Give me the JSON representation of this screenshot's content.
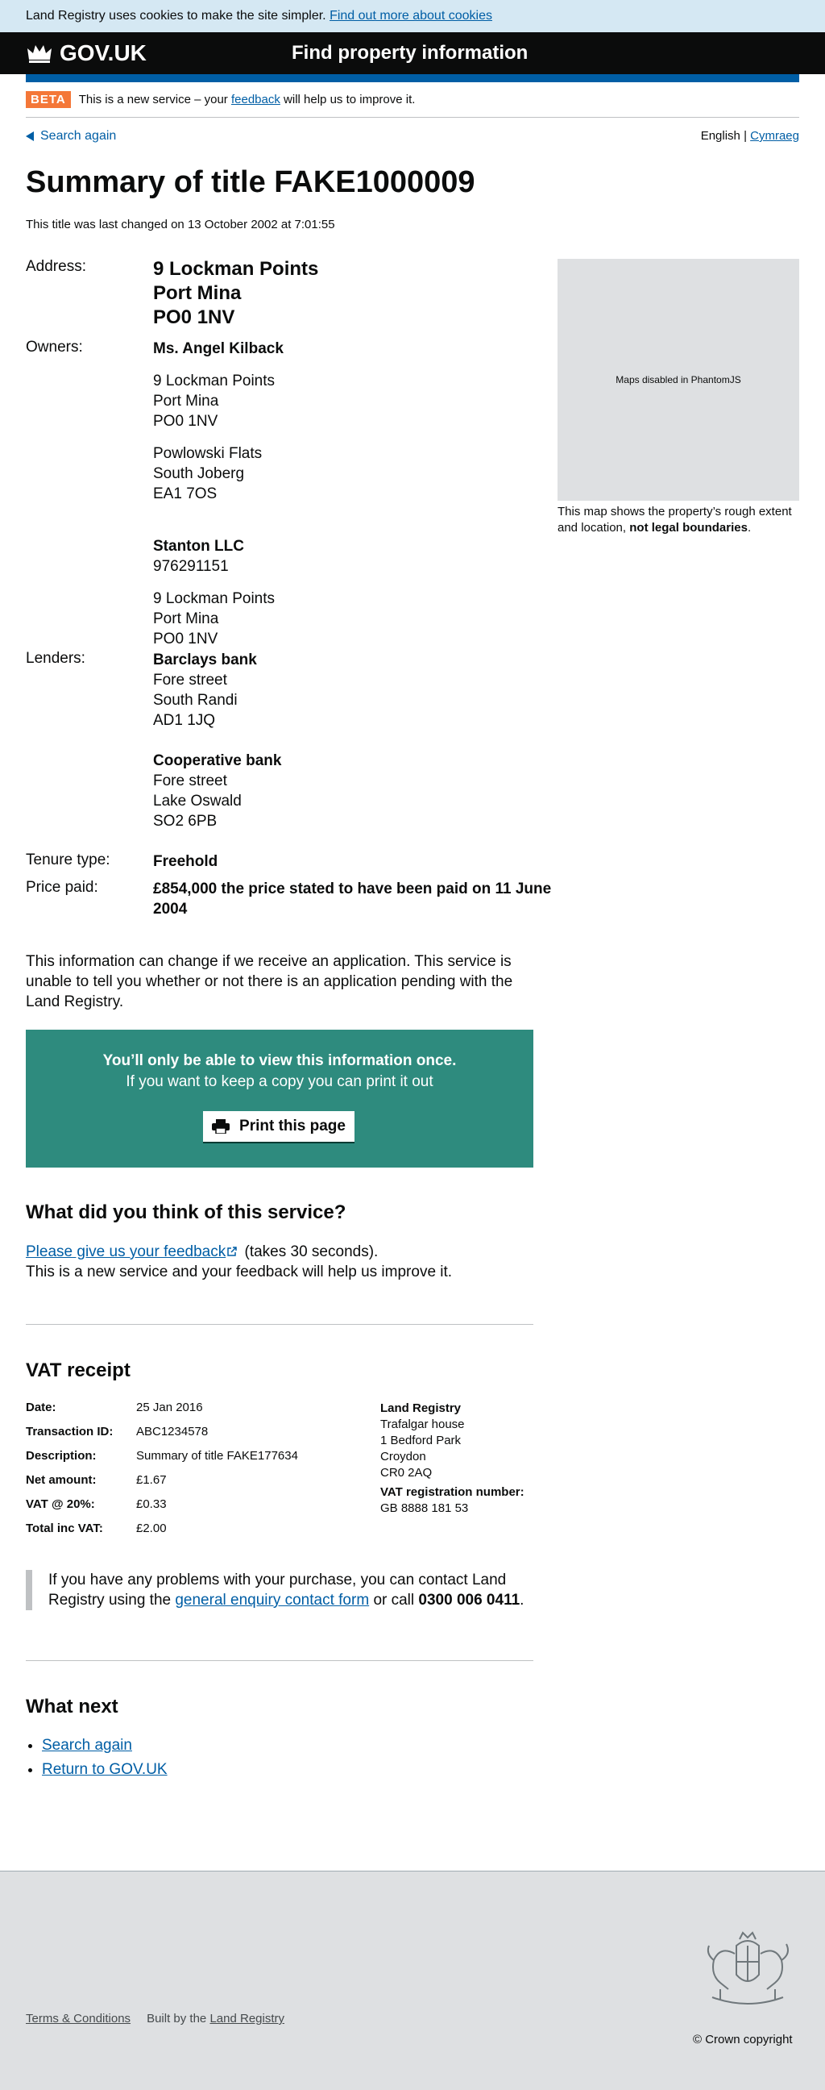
{
  "cookie": {
    "text": "Land Registry uses cookies to make the site simpler.",
    "link": "Find out more about cookies"
  },
  "header": {
    "logo": "GOV.UK",
    "service": "Find property information"
  },
  "beta": {
    "tag": "BETA",
    "pre": "This is a new service – your",
    "link": "feedback",
    "post": "will help us to improve it."
  },
  "nav": {
    "back": "Search again",
    "lang_en": "English |",
    "lang_cy": "Cymraeg"
  },
  "title": "Summary of title FAKE1000009",
  "changed": "This title was last changed on 13 October 2002 at 7:01:55",
  "labels": {
    "address": "Address:",
    "owners": "Owners:",
    "lenders": "Lenders:",
    "tenure": "Tenure type:",
    "price": "Price paid:"
  },
  "address": [
    "9 Lockman Points",
    "Port Mina",
    "PO0 1NV"
  ],
  "owners": {
    "o1_name": "Ms. Angel Kilback",
    "o1_addr1": [
      "9 Lockman Points",
      "Port Mina",
      "PO0 1NV"
    ],
    "o1_addr2": [
      "Powlowski Flats",
      "South Joberg",
      "EA1 7OS"
    ],
    "o2_name": "Stanton LLC",
    "o2_number": "976291151",
    "o2_addr": [
      "9 Lockman Points",
      "Port Mina",
      "PO0 1NV"
    ]
  },
  "lenders": {
    "l1_name": "Barclays bank",
    "l1_addr": [
      "Fore street",
      "South Randi",
      "AD1 1JQ"
    ],
    "l2_name": "Cooperative bank",
    "l2_addr": [
      "Fore street",
      "Lake Oswald",
      "SO2 6PB"
    ]
  },
  "tenure": "Freehold",
  "price": [
    "£854,000 the price stated to have been paid on 11 June",
    "2004"
  ],
  "map": {
    "placeholder": "Maps disabled in PhantomJS",
    "caption": "This map shows the property’s rough extent and location,",
    "caption_bold": "not legal boundaries",
    "caption_end": "."
  },
  "info": [
    "This information can change if we receive an application. This service is",
    "unable to tell you whether or not there is an application pending with the",
    "Land Registry."
  ],
  "print": {
    "line1": "You’ll only be able to view this information once.",
    "line2": "If you want to keep a copy you can print it out",
    "button": "Print this page"
  },
  "feedback": {
    "heading": "What did you think of this service?",
    "link": "Please give us your feedback",
    "after": "(takes 30 seconds).",
    "line2": "This is a new service and your feedback will help us improve it."
  },
  "vat": {
    "heading": "VAT receipt",
    "rows": [
      {
        "k": "Date:",
        "v": "25 Jan 2016"
      },
      {
        "k": "Transaction ID:",
        "v": "ABC1234578"
      },
      {
        "k": "Description:",
        "v": "Summary of title FAKE177634"
      },
      {
        "k": "Net amount:",
        "v": "£1.67"
      },
      {
        "k": "VAT @ 20%:",
        "v": "£0.33"
      },
      {
        "k": "Total inc VAT:",
        "v": "£2.00"
      }
    ],
    "lr_name": "Land Registry",
    "lr_addr": [
      "Trafalgar house",
      "1 Bedford Park",
      "Croydon",
      "CR0 2AQ"
    ],
    "reg_label": "VAT registration number:",
    "reg_number": "GB 8888 181 53"
  },
  "contact": {
    "pre": "If you have any problems with your purchase, you can contact Land Registry using the",
    "link": "general enquiry contact form",
    "mid": "or call",
    "phone": "0300 006 0411",
    "end": "."
  },
  "next": {
    "heading": "What next",
    "items": [
      "Search again",
      "Return to GOV.UK"
    ]
  },
  "footer": {
    "terms": "Terms & Conditions",
    "built": "Built by the",
    "built_link": "Land Registry",
    "copyright": "© Crown copyright"
  }
}
